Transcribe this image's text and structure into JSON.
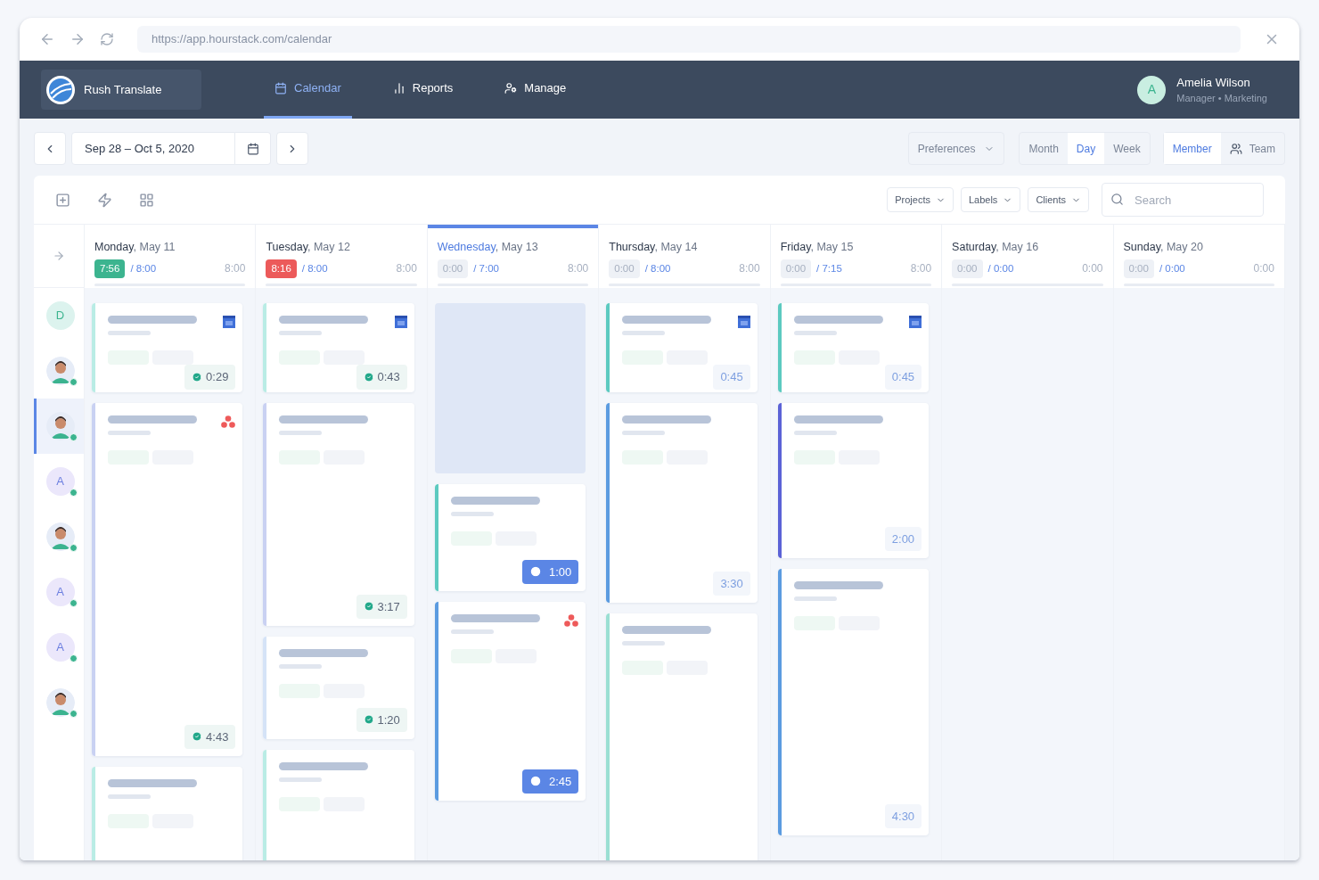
{
  "browser": {
    "url": "https://app.hourstack.com/calendar"
  },
  "nav": {
    "workspace": "Rush Translate",
    "tabs": [
      {
        "label": "Calendar",
        "selected": true
      },
      {
        "label": "Reports",
        "selected": false
      },
      {
        "label": "Manage",
        "selected": false
      }
    ],
    "user": {
      "initial": "A",
      "name": "Amelia Wilson",
      "role": "Manager • Marketing"
    }
  },
  "toolbar": {
    "date_range": "Sep 28 – Oct 5, 2020",
    "preferences": "Preferences",
    "views": [
      {
        "label": "Month",
        "selected": false
      },
      {
        "label": "Day",
        "selected": true
      },
      {
        "label": "Week",
        "selected": false
      }
    ],
    "scopes": [
      {
        "label": "Member",
        "selected": true
      },
      {
        "label": "Team",
        "selected": false
      }
    ]
  },
  "filters": [
    {
      "label": "Projects"
    },
    {
      "label": "Labels"
    },
    {
      "label": "Clients"
    }
  ],
  "search": {
    "placeholder": "Search"
  },
  "people": [
    {
      "kind": "letter",
      "letter": "D",
      "online": false,
      "selected": false
    },
    {
      "kind": "figure",
      "online": true,
      "selected": false
    },
    {
      "kind": "figure",
      "online": true,
      "selected": true
    },
    {
      "kind": "letter",
      "letter": "A",
      "online": true,
      "selected": false
    },
    {
      "kind": "figure",
      "online": true,
      "selected": false
    },
    {
      "kind": "letter",
      "letter": "A",
      "online": true,
      "selected": false
    },
    {
      "kind": "letter",
      "letter": "A",
      "online": true,
      "selected": false
    },
    {
      "kind": "figure",
      "online": true,
      "selected": false
    }
  ],
  "days": [
    {
      "title": "**Monday**, May 11",
      "selected": false,
      "worked": "7:56",
      "logged": true,
      "over": false,
      "target": "/ 8:00",
      "total": "8:00",
      "entries": [
        {
          "kind": "entry",
          "color": "#b9ece5",
          "calendar": true,
          "badge": {
            "kind": "done",
            "text": "0:29"
          }
        },
        {
          "kind": "entry",
          "color": "#c9d1f2",
          "asana": true,
          "badge": {
            "kind": "done",
            "text": "4:43"
          }
        },
        {
          "kind": "entry",
          "color": "#b9ece5"
        }
      ]
    },
    {
      "title": "**Tuesday**, May 12",
      "selected": false,
      "worked": "8:16",
      "logged": true,
      "over": true,
      "target": "/ 8:00",
      "total": "8:00",
      "entries": [
        {
          "kind": "entry",
          "color": "#b9ece5",
          "calendar": true,
          "badge": {
            "kind": "done",
            "text": "0:43"
          }
        },
        {
          "kind": "entry",
          "color": "#c9d1f2",
          "badge": {
            "kind": "done",
            "text": "3:17"
          }
        },
        {
          "kind": "entry",
          "color": "#d5e3f7",
          "badge": {
            "kind": "done",
            "text": "1:20"
          }
        },
        {
          "kind": "entry",
          "color": "#b9ece5"
        }
      ]
    },
    {
      "title": "**Wednesday**, May 13",
      "selected": true,
      "worked": "0:00",
      "logged": false,
      "over": false,
      "target": "/ 7:00",
      "total": "8:00",
      "entries": [
        {
          "kind": "placeholder"
        },
        {
          "kind": "entry",
          "color": "#5ccac0",
          "badge": {
            "kind": "running",
            "text": "1:00"
          }
        },
        {
          "kind": "entry",
          "color": "#5b9be0",
          "asana": true,
          "badge": {
            "kind": "running",
            "text": "2:45"
          }
        }
      ]
    },
    {
      "title": "**Thursday**, May 14",
      "selected": false,
      "worked": "0:00",
      "logged": false,
      "over": false,
      "target": "/ 8:00",
      "total": "8:00",
      "entries": [
        {
          "kind": "entry",
          "color": "#5ccac0",
          "calendar": true,
          "badge": {
            "kind": "plain",
            "text": "0:45"
          }
        },
        {
          "kind": "entry",
          "color": "#5b9be0",
          "badge": {
            "kind": "plain",
            "text": "3:30"
          }
        },
        {
          "kind": "entry",
          "color": "#9adfd3"
        }
      ]
    },
    {
      "title": "**Friday**, May 15",
      "selected": false,
      "worked": "0:00",
      "logged": false,
      "over": false,
      "target": "/ 7:15",
      "total": "8:00",
      "entries": [
        {
          "kind": "entry",
          "color": "#5ccac0",
          "calendar": true,
          "badge": {
            "kind": "plain",
            "text": "0:45"
          }
        },
        {
          "kind": "entry",
          "color": "#5b62d6",
          "badge": {
            "kind": "plain",
            "text": "2:00"
          }
        },
        {
          "kind": "entry",
          "color": "#5b9be0",
          "badge": {
            "kind": "plain",
            "text": "4:30"
          }
        }
      ]
    },
    {
      "title": "**Saturday**, May 16",
      "selected": false,
      "worked": "0:00",
      "logged": false,
      "over": false,
      "target": "/ 0:00",
      "total": "0:00"
    },
    {
      "title": "**Sunday**, May 20",
      "selected": false,
      "worked": "0:00",
      "logged": false,
      "over": false,
      "target": "/ 0:00",
      "total": "0:00"
    }
  ]
}
